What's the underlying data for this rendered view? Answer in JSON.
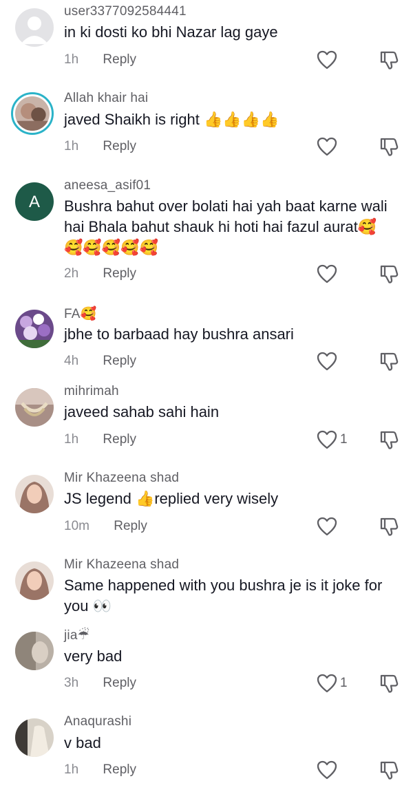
{
  "comments": [
    {
      "user": "user3377092584441",
      "text": "in ki dosti ko bhi Nazar lag gaye",
      "time": "1h",
      "reply": "Reply",
      "likes": "",
      "avatar": "default-avatar"
    },
    {
      "user": "Allah khair hai",
      "text": "javed Shaikh is right 👍👍👍👍",
      "time": "1h",
      "reply": "Reply",
      "likes": "",
      "avatar": "photo-avatar-ringed"
    },
    {
      "user": "aneesa_asif01",
      "text": "Bushra bahut over bolati hai yah baat karne wali hai Bhala bahut shauk hi hoti hai fazul aurat🥰🥰🥰🥰🥰🥰",
      "time": "2h",
      "reply": "Reply",
      "likes": "",
      "avatar": "letter-avatar",
      "avatar_letter": "A",
      "avatar_color": "#1e5a48"
    },
    {
      "user": "FA🥰",
      "text": "jbhe to barbaad hay bushra ansari",
      "time": "4h",
      "reply": "Reply",
      "likes": "",
      "avatar": "flowers-avatar"
    },
    {
      "user": "mihrimah",
      "text": "javeed sahab sahi hain",
      "time": "1h",
      "reply": "Reply",
      "likes": "1",
      "avatar": "jewelry-avatar"
    },
    {
      "user": "Mir Khazeena shad",
      "text": "JS legend 👍replied very wisely",
      "time": "10m",
      "reply": "Reply",
      "likes": "",
      "avatar": "woman-avatar"
    },
    {
      "user": "Mir Khazeena shad",
      "text": "Same happened with you bushra je is it joke for you 👀",
      "time": "",
      "reply": "",
      "likes": "",
      "avatar": "woman-avatar"
    },
    {
      "user": "jia☔",
      "text": "very bad",
      "time": "3h",
      "reply": "Reply",
      "likes": "1",
      "avatar": "blur-avatar"
    },
    {
      "user": "Anaqurashi",
      "text": "v bad",
      "time": "1h",
      "reply": "Reply",
      "likes": "",
      "avatar": "dress-avatar"
    }
  ],
  "icons": {
    "like": "heart-outline-icon",
    "dislike": "thumbs-down-icon"
  }
}
